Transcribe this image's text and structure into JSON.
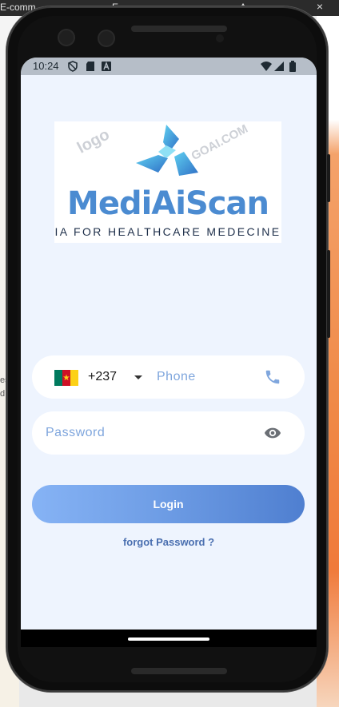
{
  "browser": {
    "tabs": [
      {
        "label": "E-comm"
      },
      {
        "label": "E"
      },
      {
        "label": "A"
      }
    ],
    "close_glyph": "×"
  },
  "desktop": {
    "edge_text_1": "es",
    "edge_text_2": "d"
  },
  "status_bar": {
    "time": "10:24",
    "icons": [
      "shield-icon",
      "sd-card-icon",
      "notification-a-icon",
      "wifi-icon",
      "signal-icon",
      "battery-icon"
    ]
  },
  "logo": {
    "name": "MediAiScan",
    "tagline": "IA FOR HEALTHCARE MEDECINE",
    "watermark_1": "logo",
    "watermark_2": "GOAI.COM",
    "colors": {
      "primary_blue": "#4b8bd1",
      "cyan": "#5fd0f0",
      "navy": "#1e2f4a"
    }
  },
  "form": {
    "country_code": "+237",
    "country": "Cameroon",
    "flag_colors": [
      "#007a5e",
      "#ce1126",
      "#fcd116"
    ],
    "phone_placeholder": "Phone",
    "password_placeholder": "Password",
    "login_label": "Login",
    "forgot_label": "forgot Password ?"
  },
  "theme": {
    "screen_bg": "#eef4fe",
    "accent": "#6f9ee6",
    "link": "#4a6fb0"
  }
}
